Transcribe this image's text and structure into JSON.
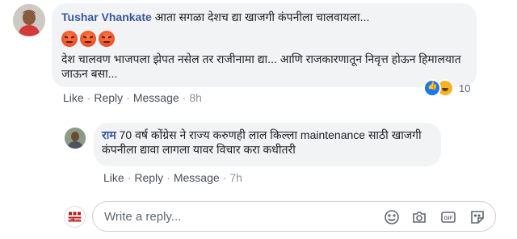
{
  "comment": {
    "author": "Tushar Vhankate",
    "text_line1": "आता सगळा देशच द्या खाजगी कंपनीला चालवायला...",
    "reaction_emojis": [
      "angry-face-icon",
      "angry-face-icon",
      "angry-face-icon"
    ],
    "text_body": "देश चालवण भाजपला झेपत नसेल तर राजीनामा द्या... आणि राजकारणातून निवृत्त होऊन हिमालयात जाऊन बसा...",
    "reactions": {
      "icons": [
        "like-icon",
        "haha-icon"
      ],
      "count": "10"
    },
    "actions": {
      "like": "Like",
      "reply": "Reply",
      "message": "Message",
      "time": "8h"
    }
  },
  "reply": {
    "author": "राम",
    "text": "70 वर्ष कोंग्रेस ने राज्य करुणही लाल किल्ला maintenance साठी खाजगी कंपनीला द्यावा लागला यावर विचार करा कधीतरी",
    "actions": {
      "like": "Like",
      "reply": "Reply",
      "message": "Message",
      "time": "7h"
    }
  },
  "composer": {
    "placeholder": "Write a reply...",
    "page_badge": "BBC NEWS",
    "icons": [
      "emoji-icon",
      "camera-icon",
      "gif-icon",
      "sticker-icon"
    ],
    "gif_label": "GIF"
  },
  "colors": {
    "link": "#385898",
    "bubble": "#f2f3f5",
    "meta": "#606770",
    "like_blue": "#1877f2",
    "bbc_red": "#bb1919"
  }
}
